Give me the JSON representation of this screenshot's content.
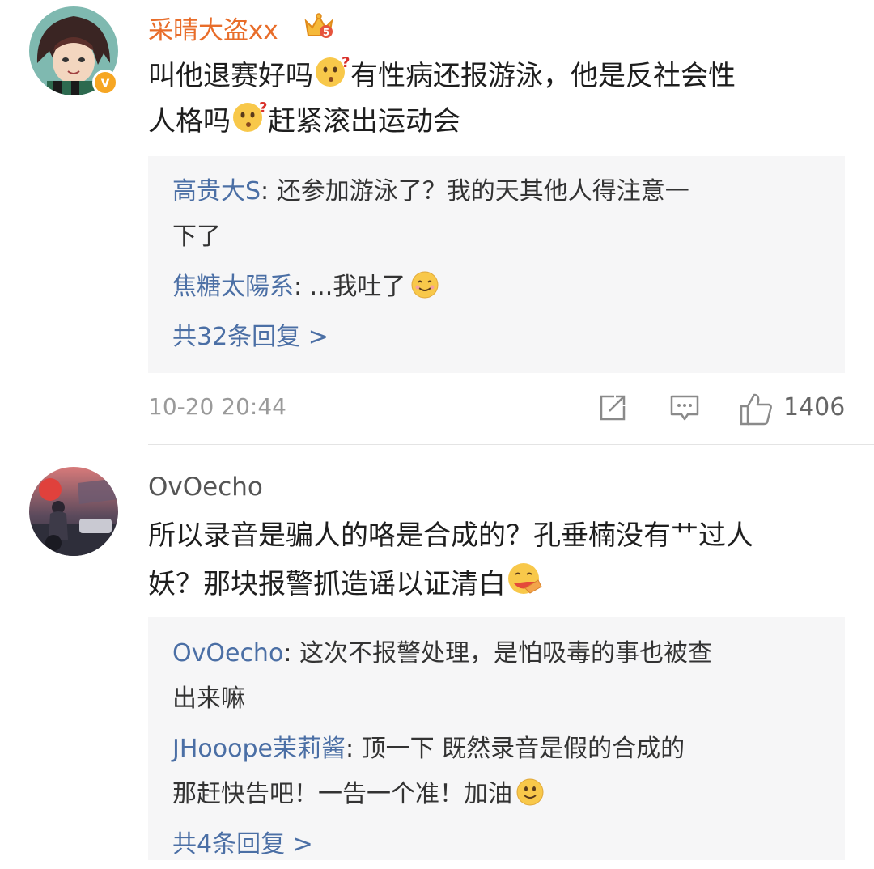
{
  "comments": [
    {
      "username": "采晴大盗xx",
      "lines": [
        [
          "叫他退赛好吗",
          "有性病还报游泳，他是反社会性"
        ],
        [
          "人格吗",
          "赶紧滚出运动会"
        ]
      ],
      "replies": [
        {
          "name": "高贵大S",
          "text_l1": ": 还参加游泳了？我的天其他人得注意一",
          "text_l2": "下了"
        },
        {
          "name": "焦糖太陽系",
          "text_l1": ": ...我吐了"
        }
      ],
      "more_replies": "共32条回复 >",
      "time": "10-20 20:44",
      "likes": "1406"
    },
    {
      "username": "OvOecho",
      "lines": [
        [
          "所以录音是骗人的咯是合成的？孔垂楠没有艹过人"
        ],
        [
          "妖？那块报警抓造谣以证清白"
        ]
      ],
      "replies": [
        {
          "name": "OvOecho",
          "text_l1": ": 这次不报警处理，是怕吸毒的事也被查",
          "text_l2": "出来嘛"
        },
        {
          "name": "JHooope茉莉酱",
          "text_l1": ": 顶一下  既然录音是假的合成的",
          "text_l2": "那赶快告吧！一告一个准！加油"
        }
      ],
      "more_replies": "共4条回复 >"
    }
  ],
  "icons": {
    "verified": "v",
    "crown_level": "5"
  },
  "colors": {
    "vip_name": "#e86d2a",
    "reply_name": "#4b6fa5",
    "reply_bg": "#f6f6f7",
    "verified_badge": "#f6a623"
  }
}
